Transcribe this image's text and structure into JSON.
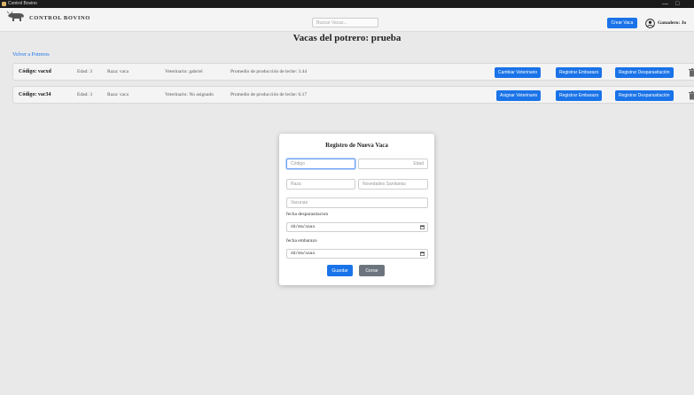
{
  "window": {
    "title": "Control Bovino",
    "minimize": "—",
    "maximize": "□"
  },
  "header": {
    "brand": "CONTROL BOVINO",
    "search_placeholder": "Buscar Vacas...",
    "create_button": "Crear Vaca",
    "user_label": "Ganadero: Jo"
  },
  "page": {
    "title": "Vacas del potrero: prueba",
    "back_link": "Volver a Potreros"
  },
  "cows": [
    {
      "code": "Código: vacxd",
      "age": "Edad: 3",
      "breed": "Raza: vaca",
      "vet": "Veterinario: gabriel",
      "milk": "Promedio de producción de leche: 3.44",
      "vet_button": "Cambiar Veterinario",
      "pregnancy_button": "Registrar Embarazo",
      "deworm_button": "Registrar Desparasitación"
    },
    {
      "code": "Código: vac34",
      "age": "Edad: 3",
      "breed": "Raza: vaca",
      "vet": "Veterinario: No asignado",
      "milk": "Promedio de producción de leche: 6.17",
      "vet_button": "Asignar Veterinario",
      "pregnancy_button": "Registrar Embarazo",
      "deworm_button": "Registrar Desparasitación"
    }
  ],
  "modal": {
    "title": "Registro de Nueva Vaca",
    "code_placeholder": "Código",
    "age_placeholder": "Edad",
    "breed_placeholder": "Raza",
    "health_placeholder": "Novedades Sanitarias",
    "vaccines_placeholder": "Vacunas",
    "deworm_label": "fecha desparasitacion",
    "deworm_date": "dd/mm/aaaa",
    "pregnancy_label": "fecha embarazo",
    "pregnancy_date": "dd/mm/aaaa",
    "save_button": "Guardar",
    "close_button": "Cerrar"
  },
  "colors": {
    "accent": "#1a73e8",
    "secondary": "#6c757d",
    "background": "#e9e9e9"
  }
}
